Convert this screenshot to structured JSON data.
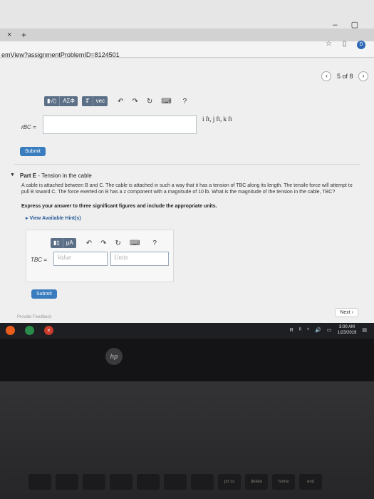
{
  "browser": {
    "tab_close": "×",
    "tab_new": "+",
    "window_controls": [
      "–",
      "▢"
    ],
    "url": "emView?assignmentProblemID=8124501",
    "url_icons": [
      "☆",
      "▯"
    ],
    "extension_label": "D"
  },
  "pager": {
    "prev": "‹",
    "text": "5 of 8",
    "next": "›"
  },
  "part_d": {
    "toolbar_buttons": [
      "▮√▯",
      "ΑΣΦ",
      "↕⃗",
      "vec"
    ],
    "undo": "↶",
    "redo": "↷",
    "reset": "↻",
    "keyboard": "⌨",
    "help": "?",
    "label": "rBC =",
    "units": "i ft, j ft, k ft",
    "submit": "Submit"
  },
  "part_e": {
    "caret": "▼",
    "title_prefix": "Part E",
    "title_rest": " - Tension in the cable",
    "problem_text": "A cable is attached between B and C. The cable is attached in such a way that it has a tension of TBC along its length. The tensile force will attempt to pull B toward C. The force exerted on B has a z component with a magnitude of 10 lb. What is the magnitude of the tension in the cable, TBC?",
    "instruction": "Express your answer to three significant figures and include the appropriate units.",
    "hints": "▸ View Available Hint(s)",
    "toolbar_buttons": [
      "▮▯",
      "μA"
    ],
    "undo": "↶",
    "redo": "↷",
    "reset": "↻",
    "keyboard": "⌨",
    "help": "?",
    "label": "TBC =",
    "value_placeholder": "Value",
    "units_placeholder": "Units",
    "submit": "Submit"
  },
  "footer": {
    "feedback": "Provide Feedback",
    "next": "Next ›"
  },
  "taskbar": {
    "tray": [
      "R",
      "ᴿ",
      "^",
      "🔊",
      "▭"
    ],
    "time": "3:00 AM",
    "date": "1/23/2019",
    "notify": "▤"
  },
  "laptop": {
    "logo": "hp",
    "keys": [
      "",
      "",
      "",
      "",
      "",
      "",
      "",
      "prt sc",
      "delete",
      "home",
      "end"
    ]
  }
}
